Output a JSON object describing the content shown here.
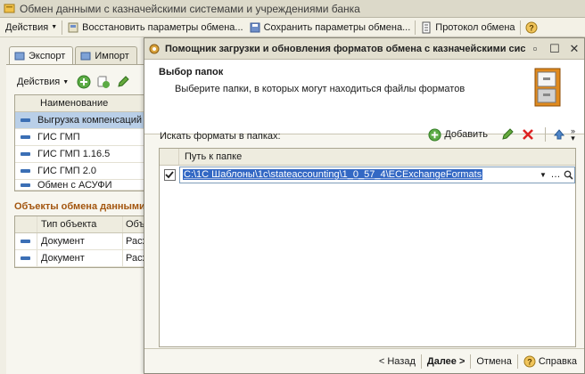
{
  "bg_window": {
    "title": "Обмен данными с казначейскими системами и учреждениями банка",
    "toolbar": {
      "actions": "Действия",
      "restore": "Восстановить параметры обмена...",
      "save": "Сохранить параметры обмена...",
      "protocol": "Протокол обмена"
    },
    "tabs": [
      "Экспорт",
      "Импорт"
    ],
    "panel_actions": "Действия",
    "list": {
      "header": "Наименование",
      "rows": [
        "Выгрузка компенсаций",
        "ГИС ГМП",
        "ГИС ГМП 1.16.5",
        "ГИС ГМП 2.0",
        "Обмен с АСУФИ"
      ]
    },
    "objects_title": "Объекты обмена данными",
    "objects": {
      "headers": [
        "Тип объекта",
        "Объект"
      ],
      "rows": [
        [
          "Документ",
          "Расход"
        ],
        [
          "Документ",
          "Расход"
        ]
      ]
    }
  },
  "dialog": {
    "title": "Помощник загрузки и обновления форматов обмена с казначейскими системами",
    "header_title": "Выбор папок",
    "header_subtitle": "Выберите папки, в которых могут находиться файлы форматов",
    "search_label": "Искать форматы в папках:",
    "add_label": "Добавить",
    "grid_header": "Путь к папке",
    "path_value": "C:\\1C Шаблоны\\1c\\stateaccounting\\1_0_57_4\\ECExchangeFormats",
    "path_checked": true,
    "footer": {
      "back": "< Назад",
      "next": "Далее >",
      "cancel": "Отмена",
      "help": "Справка"
    }
  },
  "colors": {
    "accent_orange": "#a3560f",
    "selection_blue": "#3368c4"
  }
}
